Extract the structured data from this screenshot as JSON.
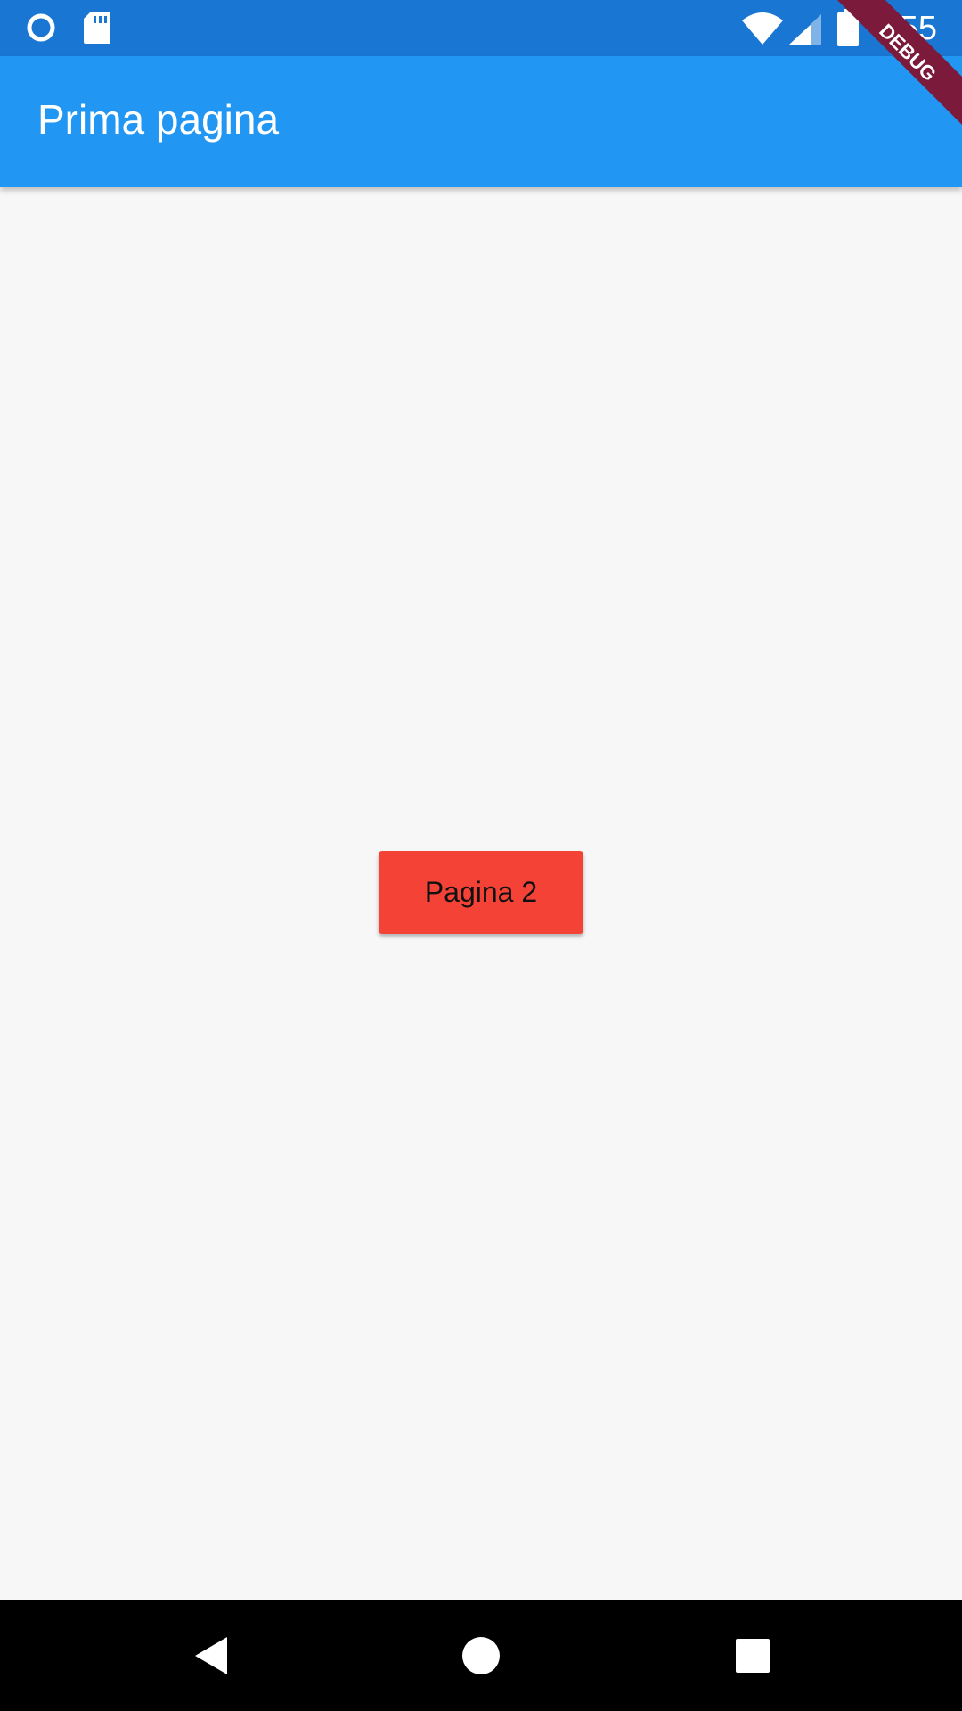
{
  "status_bar": {
    "time": "4:55",
    "icons": [
      "sync-icon",
      "sd-card-icon",
      "wifi-icon",
      "cell-signal-icon",
      "battery-icon"
    ]
  },
  "app_bar": {
    "title": "Prima pagina"
  },
  "debug_banner": {
    "label": "DEBUG"
  },
  "main": {
    "button_label": "Pagina 2"
  },
  "nav_bar": {
    "icons": [
      "back-icon",
      "home-icon",
      "recents-icon"
    ]
  },
  "colors": {
    "status_bar": "#1976d2",
    "app_bar": "#2196f3",
    "background": "#f7f7f7",
    "button": "#f44336",
    "debug_banner": "#7b1a3a",
    "nav_bar": "#000000"
  }
}
